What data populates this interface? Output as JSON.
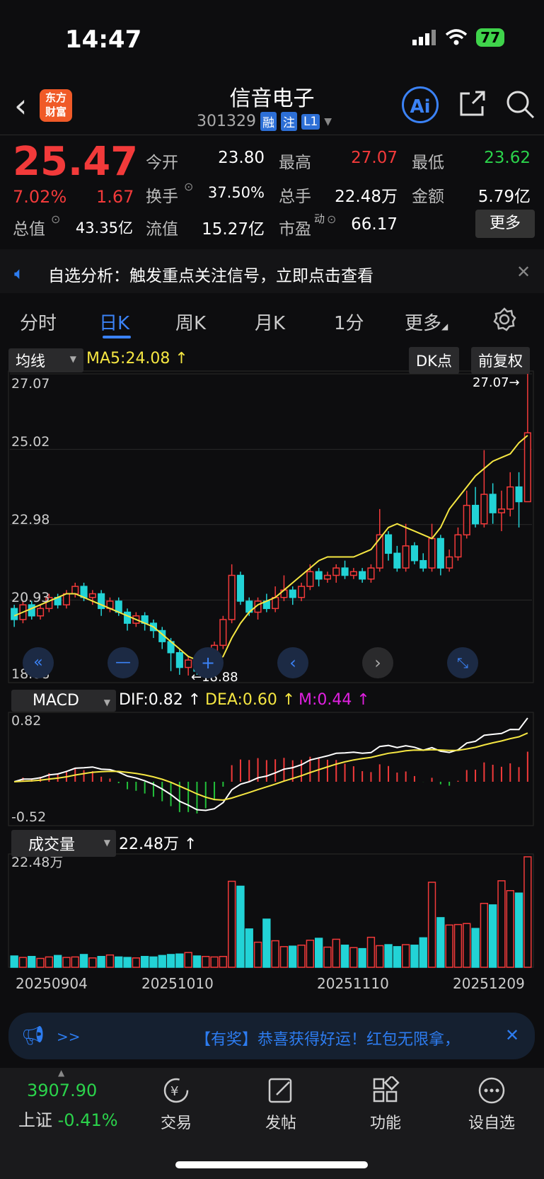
{
  "status": {
    "time": "14:47",
    "battery": "77"
  },
  "header": {
    "logo_line1": "东方",
    "logo_line2": "财富",
    "name": "信音电子",
    "code": "301329",
    "tags": [
      "融",
      "注",
      "L1"
    ],
    "ai_label": "Ai"
  },
  "quote": {
    "price": "25.47",
    "change_pct": "7.02%",
    "change_val": "1.67",
    "open_label": "今开",
    "open": "23.80",
    "high_label": "最高",
    "high": "27.07",
    "low_label": "最低",
    "low": "23.62",
    "turnover_label": "换手",
    "turnover": "37.50%",
    "volume_label": "总手",
    "volume": "22.48万",
    "amount_label": "金额",
    "amount": "5.79亿",
    "mcap_label": "总值",
    "mcap": "43.35亿",
    "float_label": "流值",
    "float": "15.27亿",
    "pe_label": "市盈",
    "pe_sup": "动",
    "pe": "66.17",
    "more_label": "更多"
  },
  "notice": {
    "text": "自选分析：触发重点关注信号，立即点击查看"
  },
  "tabs": [
    "分时",
    "日K",
    "周K",
    "月K",
    "1分",
    "更多"
  ],
  "active_tab": "日K",
  "kline": {
    "indicator": "均线",
    "ma5": "MA5:24.08",
    "dk_label": "DK点",
    "adjust_label": "前复权",
    "y_labels": [
      "27.07",
      "25.02",
      "22.98",
      "20.93",
      "18.88"
    ],
    "high_marker": "27.07→",
    "low_marker": "←18.88"
  },
  "macd": {
    "indicator": "MACD",
    "dif": "DIF:0.82",
    "dea": "DEA:0.60",
    "m": "M:0.44",
    "y_top": "0.82",
    "y_bottom": "-0.52"
  },
  "volume": {
    "indicator": "成交量",
    "value": "22.48万",
    "y_top": "22.48万"
  },
  "dates": [
    "20250904",
    "20251010",
    "20251110",
    "20251209"
  ],
  "ticker": {
    "arrow": ">>",
    "text": "【有奖】恭喜获得好运！红包无限拿，"
  },
  "bottom": {
    "index_value": "3907.90",
    "index_name": "上证",
    "index_change": "-0.41%",
    "nav": [
      "交易",
      "发帖",
      "功能",
      "设自选"
    ]
  },
  "colors": {
    "up": "#f23a3a",
    "down": "#22d3d6",
    "ma": "#f5e642",
    "dif": "#ffffff",
    "m": "#e020e0",
    "accent": "#3b82f6"
  },
  "chart_data": [
    {
      "type": "candlestick",
      "title": "",
      "ylim": [
        18.88,
        27.07
      ],
      "series": [
        {
          "name": "MA5",
          "values": [
            20.5,
            20.6,
            20.7,
            20.8,
            20.9,
            21.0,
            21.1,
            21.1,
            21.0,
            20.9,
            20.8,
            20.7,
            20.6,
            20.5,
            20.4,
            20.3,
            20.2,
            20.0,
            19.8,
            19.6,
            19.4,
            19.3,
            19.2,
            19.2,
            19.4,
            19.9,
            20.3,
            20.6,
            20.8,
            20.9,
            21.0,
            21.2,
            21.4,
            21.6,
            21.8,
            22.0,
            22.1,
            22.1,
            22.1,
            22.1,
            22.2,
            22.3,
            22.6,
            22.9,
            23.0,
            22.9,
            22.8,
            22.7,
            22.6,
            22.9,
            23.4,
            23.7,
            24.0,
            24.3,
            24.5,
            24.7,
            24.8,
            24.9,
            25.2,
            25.4,
            25.8
          ]
        }
      ],
      "ohlc": [
        [
          20.7,
          20.4,
          20.8,
          20.2
        ],
        [
          20.4,
          20.8,
          20.9,
          20.3
        ],
        [
          20.8,
          20.5,
          20.9,
          20.4
        ],
        [
          20.5,
          20.7,
          20.8,
          20.4
        ],
        [
          20.7,
          21.0,
          21.1,
          20.6
        ],
        [
          21.0,
          20.8,
          21.1,
          20.7
        ],
        [
          20.8,
          21.1,
          21.2,
          20.7
        ],
        [
          21.1,
          21.3,
          21.4,
          21.0
        ],
        [
          21.3,
          21.0,
          21.4,
          20.9
        ],
        [
          21.0,
          21.1,
          21.2,
          20.8
        ],
        [
          21.1,
          20.7,
          21.2,
          20.5
        ],
        [
          20.7,
          20.9,
          21.0,
          20.6
        ],
        [
          20.9,
          20.6,
          21.0,
          20.5
        ],
        [
          20.6,
          20.3,
          20.7,
          20.1
        ],
        [
          20.3,
          20.5,
          20.6,
          20.2
        ],
        [
          20.5,
          20.3,
          20.6,
          20.1
        ],
        [
          20.3,
          20.1,
          20.4,
          19.9
        ],
        [
          20.1,
          19.8,
          20.2,
          19.6
        ],
        [
          19.8,
          19.5,
          19.9,
          19.0
        ],
        [
          19.5,
          19.1,
          19.6,
          18.9
        ],
        [
          19.1,
          19.3,
          19.4,
          18.88
        ],
        [
          19.3,
          19.0,
          19.4,
          18.9
        ],
        [
          19.0,
          19.4,
          19.5,
          18.9
        ],
        [
          19.4,
          19.7,
          19.8,
          19.3
        ],
        [
          19.7,
          20.4,
          20.5,
          19.6
        ],
        [
          20.4,
          21.6,
          21.9,
          20.3
        ],
        [
          21.6,
          20.9,
          21.7,
          20.8
        ],
        [
          20.9,
          20.6,
          21.0,
          20.5
        ],
        [
          20.6,
          20.9,
          21.0,
          20.4
        ],
        [
          20.9,
          20.7,
          21.1,
          20.6
        ],
        [
          20.7,
          21.0,
          21.3,
          20.6
        ],
        [
          21.0,
          21.2,
          21.6,
          20.9
        ],
        [
          21.2,
          21.0,
          21.3,
          20.8
        ],
        [
          21.0,
          21.3,
          21.4,
          20.9
        ],
        [
          21.3,
          21.7,
          21.9,
          21.2
        ],
        [
          21.7,
          21.5,
          21.8,
          21.3
        ],
        [
          21.5,
          21.6,
          21.7,
          21.4
        ],
        [
          21.6,
          21.8,
          21.9,
          21.4
        ],
        [
          21.8,
          21.6,
          22.0,
          21.5
        ],
        [
          21.6,
          21.7,
          21.8,
          21.5
        ],
        [
          21.7,
          21.5,
          21.8,
          21.4
        ],
        [
          21.5,
          21.8,
          21.9,
          21.4
        ],
        [
          21.8,
          22.7,
          23.4,
          21.7
        ],
        [
          22.7,
          22.2,
          22.8,
          22.0
        ],
        [
          22.2,
          21.8,
          22.4,
          21.7
        ],
        [
          21.8,
          22.4,
          23.0,
          21.7
        ],
        [
          22.4,
          22.0,
          22.5,
          21.9
        ],
        [
          22.0,
          21.8,
          22.2,
          21.7
        ],
        [
          21.8,
          22.6,
          23.0,
          21.7
        ],
        [
          22.6,
          21.8,
          22.7,
          21.6
        ],
        [
          21.8,
          22.1,
          22.3,
          21.7
        ],
        [
          22.1,
          22.7,
          22.9,
          22.0
        ],
        [
          22.7,
          23.5,
          23.9,
          22.6
        ],
        [
          23.5,
          23.0,
          24.0,
          22.9
        ],
        [
          23.0,
          23.8,
          25.0,
          22.9
        ],
        [
          23.8,
          23.3,
          24.1,
          23.0
        ],
        [
          23.3,
          23.4,
          23.9,
          22.8
        ],
        [
          23.4,
          24.0,
          24.4,
          23.2
        ],
        [
          24.0,
          23.6,
          24.4,
          22.9
        ],
        [
          23.6,
          25.47,
          27.07,
          23.6
        ]
      ]
    },
    {
      "type": "bar",
      "title": "",
      "ylim": [
        0,
        22.48
      ],
      "series": [
        {
          "name": "成交量",
          "values": [
            2.3,
            2.0,
            2.2,
            1.8,
            2.1,
            2.4,
            2.0,
            2.1,
            2.6,
            1.9,
            2.2,
            2.5,
            2.1,
            2.0,
            1.9,
            2.2,
            2.1,
            2.4,
            2.6,
            2.7,
            3.0,
            2.3,
            2.2,
            2.1,
            2.2,
            17.5,
            16.5,
            7.8,
            5.1,
            9.8,
            5.4,
            4.2,
            4.3,
            4.5,
            5.5,
            5.9,
            4.1,
            5.7,
            4.5,
            4.0,
            3.8,
            6.1,
            4.4,
            4.6,
            4.2,
            4.6,
            4.5,
            6.0,
            17.3,
            10.1,
            8.6,
            8.7,
            8.9,
            7.9,
            13.0,
            12.7,
            17.6,
            15.6,
            15.1,
            22.48
          ]
        }
      ]
    }
  ]
}
